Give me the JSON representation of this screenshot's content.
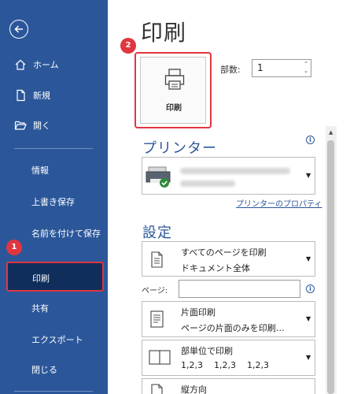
{
  "sidebar": {
    "home_label": "ホーム",
    "new_label": "新規",
    "open_label": "開く",
    "info_label": "情報",
    "save_label": "上書き保存",
    "save_as_label": "名前を付けて保存",
    "print_label": "印刷",
    "share_label": "共有",
    "export_label": "エクスポート",
    "close_label": "閉じる"
  },
  "badges": {
    "one": "1",
    "two": "2"
  },
  "main": {
    "title": "印刷",
    "print_button_label": "印刷",
    "copies_label": "部数:",
    "copies_value": "1",
    "printer_heading": "プリンター",
    "printer_properties_link": "プリンターのプロパティ",
    "settings_heading": "設定",
    "print_range": {
      "line1": "すべてのページを印刷",
      "line2": "ドキュメント全体"
    },
    "pages_label": "ページ:",
    "sides": {
      "line1": "片面印刷",
      "line2": "ページの片面のみを印刷…"
    },
    "collate": {
      "line1": "部単位で印刷",
      "line2": "1,2,3    1,2,3    1,2,3"
    },
    "orientation": {
      "line1": "縦方向"
    }
  },
  "info_glyph": "i",
  "colors": {
    "sidebar": "#2b579a",
    "accent": "#2b579a",
    "highlight": "#e0363f"
  }
}
